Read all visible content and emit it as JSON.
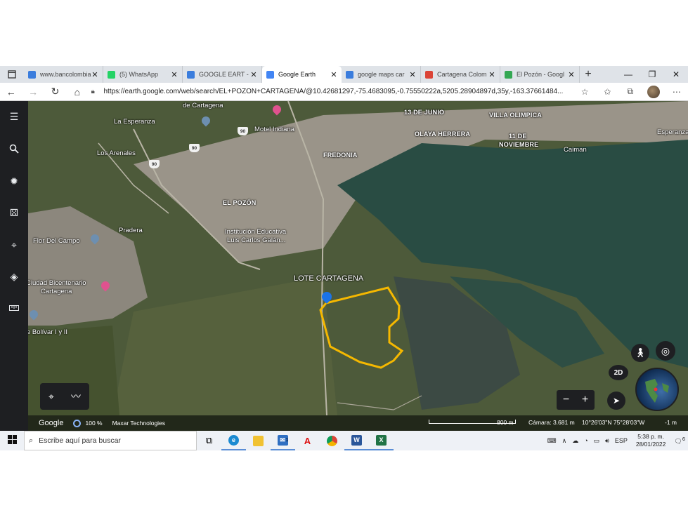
{
  "browser": {
    "tabs": [
      {
        "title": "www.bancolombia",
        "favicon": "bancolombia-icon",
        "color": "#3b7ddd",
        "active": false
      },
      {
        "title": "(5) WhatsApp",
        "favicon": "whatsapp-icon",
        "color": "#25d366",
        "active": false
      },
      {
        "title": "GOOGLE EART - ",
        "favicon": "bancolombia-icon",
        "color": "#3b7ddd",
        "active": false
      },
      {
        "title": "Google Earth",
        "favicon": "google-earth-icon",
        "color": "#4285f4",
        "active": true
      },
      {
        "title": "google maps car",
        "favicon": "bancolombia-icon",
        "color": "#3b7ddd",
        "active": false
      },
      {
        "title": "Cartagena Colom",
        "favicon": "location-pin-icon",
        "color": "#db4437",
        "active": false
      },
      {
        "title": "El Pozón - Googl",
        "favicon": "google-maps-icon",
        "color": "#34a853",
        "active": false
      }
    ],
    "url": "https://earth.google.com/web/search/EL+POZON+CARTAGENA/@10.42681297,-75.4683095,-0.75550222a,5205.28904897d,35y,-163.37661484..."
  },
  "map": {
    "places": [
      {
        "text": "de Cartagena",
        "bold": false
      },
      {
        "text": "La Esperanza",
        "bold": false
      },
      {
        "text": "Motel Indiana",
        "bold": false
      },
      {
        "text": "13 DE JUNIO",
        "bold": true
      },
      {
        "text": "VILLA OLIMPICA",
        "bold": true
      },
      {
        "text": "OLAYA HERRERA",
        "bold": true
      },
      {
        "text": "11 DE",
        "bold": true
      },
      {
        "text": "NOVIEMBRE",
        "bold": true
      },
      {
        "text": "Esperanza",
        "bold": false
      },
      {
        "text": "Caiman",
        "bold": false
      },
      {
        "text": "Los Arenales",
        "bold": false
      },
      {
        "text": "FREDONIA",
        "bold": true
      },
      {
        "text": "EL POZÓN",
        "bold": true
      },
      {
        "text": "Pradera",
        "bold": false
      },
      {
        "text": "Institución Educativa",
        "bold": false
      },
      {
        "text": "Luis Carlos Galán...",
        "bold": false
      },
      {
        "text": "Flor Del Campo",
        "bold": false
      },
      {
        "text": "LOTE CARTAGENA",
        "bold": false
      },
      {
        "text": "Ciudad Bicentenario",
        "bold": false
      },
      {
        "text": "Cartagena",
        "bold": false
      },
      {
        "text": "e Bolívar I y II",
        "bold": false
      }
    ],
    "road_shields": [
      "90",
      "90",
      "90"
    ],
    "lot_outline_color": "#f5b800",
    "pin_color": "#1a73e8"
  },
  "controls": {
    "view_mode": "2D",
    "zoom_in": "+",
    "zoom_out": "−"
  },
  "status": {
    "brand": "Google",
    "load": "100 %",
    "attribution": "Maxar Technologies",
    "scale": "800 m",
    "camera": "Cámara: 3.681 m",
    "coords": "10°26'03\"N 75°28'03\"W",
    "elevation": "-1 m"
  },
  "taskbar": {
    "search_placeholder": "Escribe aquí para buscar",
    "mail_badge": "1",
    "language": "ESP",
    "time": "5:38 p. m.",
    "date": "28/01/2022",
    "notifications": "6"
  }
}
